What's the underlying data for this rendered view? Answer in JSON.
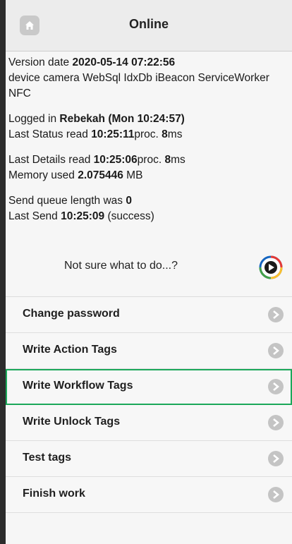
{
  "header": {
    "title": "Online",
    "home_icon": "home-icon"
  },
  "info": {
    "version_prefix": "Version date ",
    "version_date": "2020-05-14 07:22:56",
    "capabilities": "device camera WebSql IdxDb iBeacon ServiceWorker NFC",
    "logged_prefix": "Logged in ",
    "logged_user": "Rebekah (Mon 10:24:57)",
    "status_prefix": "Last Status read ",
    "status_time": "10:25:11",
    "status_proc": "proc. ",
    "status_ms": "8",
    "status_ms_unit": "ms",
    "details_prefix": "Last Details read ",
    "details_time": "10:25:06",
    "details_proc": "proc. ",
    "details_ms": "8",
    "details_ms_unit": "ms",
    "memory_prefix": "Memory used ",
    "memory_value": "2.075446",
    "memory_unit": " MB",
    "queue_prefix": "Send queue length was ",
    "queue_value": "0",
    "send_prefix": "Last Send ",
    "send_time": "10:25:09",
    "send_result": " (success)"
  },
  "help": {
    "text": "Not sure what to do...?",
    "icon": "play-help-icon"
  },
  "menu": {
    "items": [
      {
        "label": "Change password"
      },
      {
        "label": "Write Action Tags"
      },
      {
        "label": "Write Workflow Tags"
      },
      {
        "label": "Write Unlock Tags"
      },
      {
        "label": "Test tags"
      },
      {
        "label": "Finish work"
      }
    ],
    "arrow_icon": "chevron-right-icon",
    "highlight_color": "#1ba85a"
  }
}
